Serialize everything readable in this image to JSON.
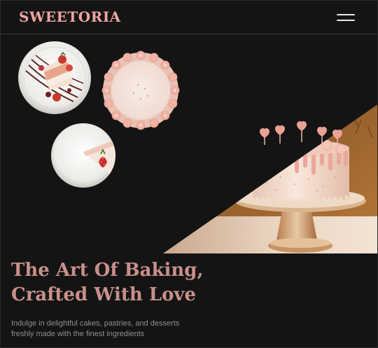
{
  "brand": {
    "name": "SWEETORIA"
  },
  "nav": {
    "menu_icon": "hamburger-menu-icon"
  },
  "hero": {
    "headline_line1": "The Art Of Baking,",
    "headline_line2": "Crafted With Love",
    "subtext_line1": "Indulge in delightful cakes, pastries, and desserts",
    "subtext_line2": "freshly made with the finest ingredients"
  },
  "colors": {
    "background": "#141414",
    "brand": "#efa6a0",
    "headline": "#c9908b",
    "subtext": "#8f8f8f"
  }
}
